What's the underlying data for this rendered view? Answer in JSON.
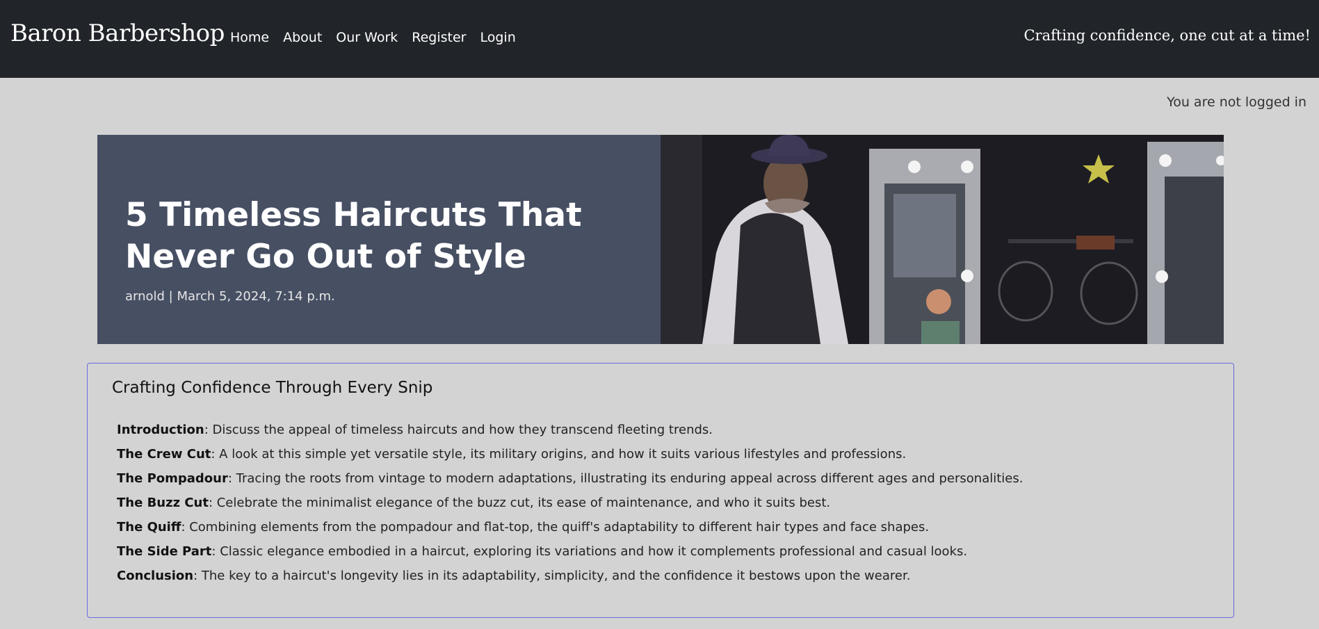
{
  "navbar": {
    "brand": "Baron Barbershop",
    "links": [
      "Home",
      "About",
      "Our Work",
      "Register",
      "Login"
    ],
    "tagline": "Crafting confidence, one cut at a time!"
  },
  "auth": {
    "status": "You are not logged in"
  },
  "post": {
    "title": "5 Timeless Haircuts That Never Go Out of Style",
    "meta": "arnold | March 5, 2024, 7:14 p.m."
  },
  "content": {
    "heading": "Crafting Confidence Through Every Snip",
    "items": [
      {
        "term": "Introduction",
        "text": ": Discuss the appeal of timeless haircuts and how they transcend fleeting trends."
      },
      {
        "term": "The Crew Cut",
        "text": ": A look at this simple yet versatile style, its military origins, and how it suits various lifestyles and professions."
      },
      {
        "term": "The Pompadour",
        "text": ": Tracing the roots from vintage to modern adaptations, illustrating its enduring appeal across different ages and personalities."
      },
      {
        "term": "The Buzz Cut",
        "text": ": Celebrate the minimalist elegance of the buzz cut, its ease of maintenance, and who it suits best."
      },
      {
        "term": "The Quiff",
        "text": ": Combining elements from the pompadour and flat-top, the quiff's adaptability to different hair types and face shapes."
      },
      {
        "term": "The Side Part",
        "text": ": Classic elegance embodied in a haircut, exploring its variations and how it complements professional and casual looks."
      },
      {
        "term": "Conclusion",
        "text": ": The key to a haircut's longevity lies in its adaptability, simplicity, and the confidence it bestows upon the wearer."
      }
    ]
  },
  "colors": {
    "navbar_bg": "#212529",
    "page_bg": "#d3d3d3",
    "hero_bg": "#474f63",
    "card_border": "#6a6ae0"
  }
}
